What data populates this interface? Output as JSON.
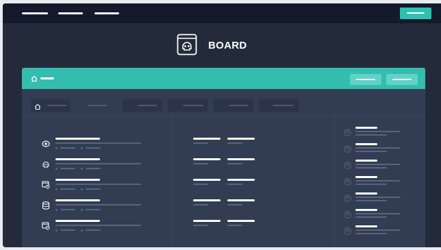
{
  "app": {
    "title": "BOARD"
  },
  "colors": {
    "accent": "#33bdae",
    "nav_background": "#131a2c",
    "page_background": "#232b3b",
    "panel_background": "#323c53"
  },
  "top_nav": {
    "items": [
      "nav-link",
      "nav-link",
      "nav-link"
    ],
    "cta_icon": "button"
  },
  "header": {
    "logo_icon": "skull-board-icon",
    "title": "BOARD"
  },
  "panel": {
    "header_icon": "home-icon",
    "actions": [
      "action-button",
      "action-button"
    ],
    "tabs": [
      {
        "icon": "home-icon",
        "active": true
      },
      {
        "active": false
      },
      {
        "active": true
      },
      {
        "active": true
      },
      {
        "active": true
      },
      {
        "active": true
      }
    ],
    "list_rows": [
      {
        "icon": "eye-icon"
      },
      {
        "icon": "skull-icon"
      },
      {
        "icon": "window-settings-icon"
      },
      {
        "icon": "database-icon"
      },
      {
        "icon": "window-settings-icon"
      }
    ],
    "right_rows": 7
  }
}
